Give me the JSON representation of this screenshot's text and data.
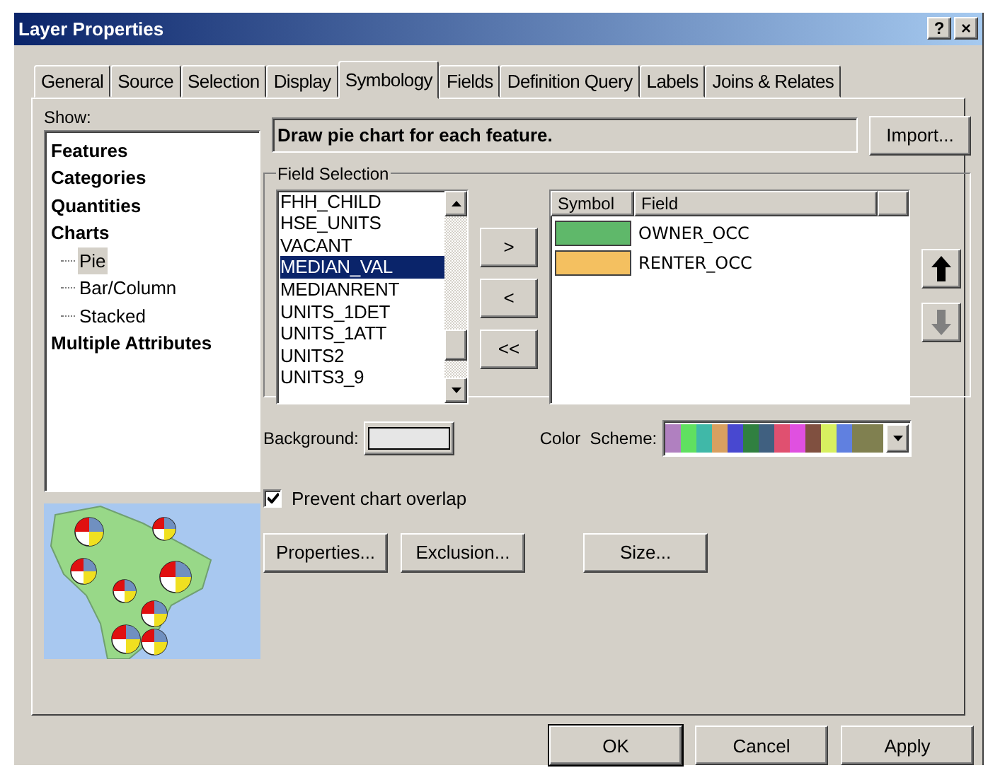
{
  "window": {
    "title": "Layer Properties",
    "help": "?",
    "close": "×"
  },
  "tabs": [
    {
      "label": "General",
      "selected": false
    },
    {
      "label": "Source",
      "selected": false
    },
    {
      "label": "Selection",
      "selected": false
    },
    {
      "label": "Display",
      "selected": false
    },
    {
      "label": "Symbology",
      "selected": true
    },
    {
      "label": "Fields",
      "selected": false
    },
    {
      "label": "Definition Query",
      "selected": false
    },
    {
      "label": "Labels",
      "selected": false
    },
    {
      "label": "Joins & Relates",
      "selected": false
    }
  ],
  "show": {
    "label": "Show:",
    "items": [
      {
        "label": "Features",
        "selected": false
      },
      {
        "label": "Categories",
        "selected": false
      },
      {
        "label": "Quantities",
        "selected": false
      },
      {
        "label": "Charts",
        "selected": false,
        "children": [
          {
            "label": "Pie",
            "selected": true
          },
          {
            "label": "Bar/Column",
            "selected": false
          },
          {
            "label": "Stacked",
            "selected": false
          }
        ]
      },
      {
        "label": "Multiple Attributes",
        "selected": false
      }
    ]
  },
  "description": "Draw pie chart for each feature.",
  "import_button": "Import...",
  "field_selection": {
    "title": "Field Selection",
    "fields": [
      {
        "label": "FHH_CHILD",
        "selected": false
      },
      {
        "label": "HSE_UNITS",
        "selected": false
      },
      {
        "label": "VACANT",
        "selected": false
      },
      {
        "label": "MEDIAN_VAL",
        "selected": true
      },
      {
        "label": "MEDIANRENT",
        "selected": false
      },
      {
        "label": "UNITS_1DET",
        "selected": false
      },
      {
        "label": "UNITS_1ATT",
        "selected": false
      },
      {
        "label": "UNITS2",
        "selected": false
      },
      {
        "label": "UNITS3_9",
        "selected": false
      }
    ],
    "move_buttons": [
      ">",
      "<",
      "<<"
    ],
    "columns": [
      "Symbol",
      "Field"
    ],
    "symbols": [
      {
        "field": "OWNER_OCC",
        "color": "#5fb86a"
      },
      {
        "field": "RENTER_OCC",
        "color": "#f4c060"
      }
    ],
    "move_up": {
      "disabled": false
    },
    "move_down": {
      "disabled": true
    }
  },
  "background": {
    "label": "Background:"
  },
  "color_scheme": {
    "label": "Color  Scheme:",
    "colors": [
      {
        "color": "#b080c0"
      },
      {
        "color": "#60e060"
      },
      {
        "color": "#40b8a8"
      },
      {
        "color": "#d8a060"
      },
      {
        "color": "#4848d0"
      },
      {
        "color": "#308040"
      },
      {
        "color": "#406080"
      },
      {
        "color": "#e05070"
      },
      {
        "color": "#e050e0"
      },
      {
        "color": "#805040"
      },
      {
        "color": "#d8f060"
      },
      {
        "color": "#6080e0"
      },
      {
        "color": "#808050"
      }
    ]
  },
  "prevent_overlap": {
    "label": "Prevent chart overlap",
    "checked": true
  },
  "action_buttons": [
    "Properties...",
    "Exclusion...",
    "Size..."
  ],
  "dialog_buttons": [
    "OK",
    "Cancel",
    "Apply"
  ]
}
